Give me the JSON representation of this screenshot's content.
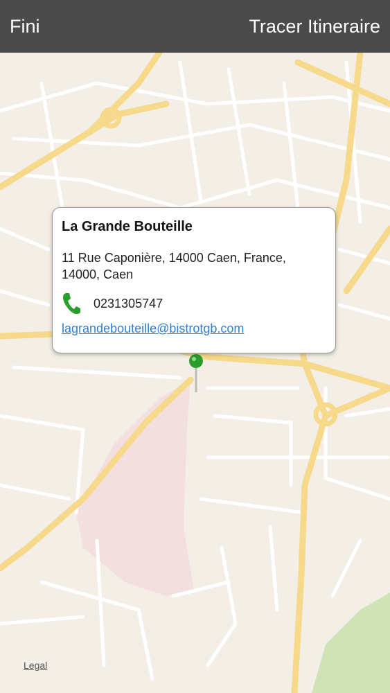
{
  "navbar": {
    "left_button": "Fini",
    "right_button": "Tracer Itineraire",
    "background": "#4a4a4a"
  },
  "map": {
    "background": "#f3efe6",
    "road_major_color": "#f7d98b",
    "road_minor_color": "#ffffff",
    "park_color": "#cfe3b6",
    "zone_color": "#f4dfe0",
    "legal_label": "Legal"
  },
  "callout": {
    "title": "La Grande Bouteille",
    "address": "11 Rue Caponière, 14000 Caen, France, 14000, Caen",
    "phone": "0231305747",
    "email": "lagrandebouteille@bistrotgb.com",
    "phone_icon": "phone-icon"
  },
  "pin": {
    "icon": "map-pin-icon",
    "color": "#2a9d2a"
  }
}
